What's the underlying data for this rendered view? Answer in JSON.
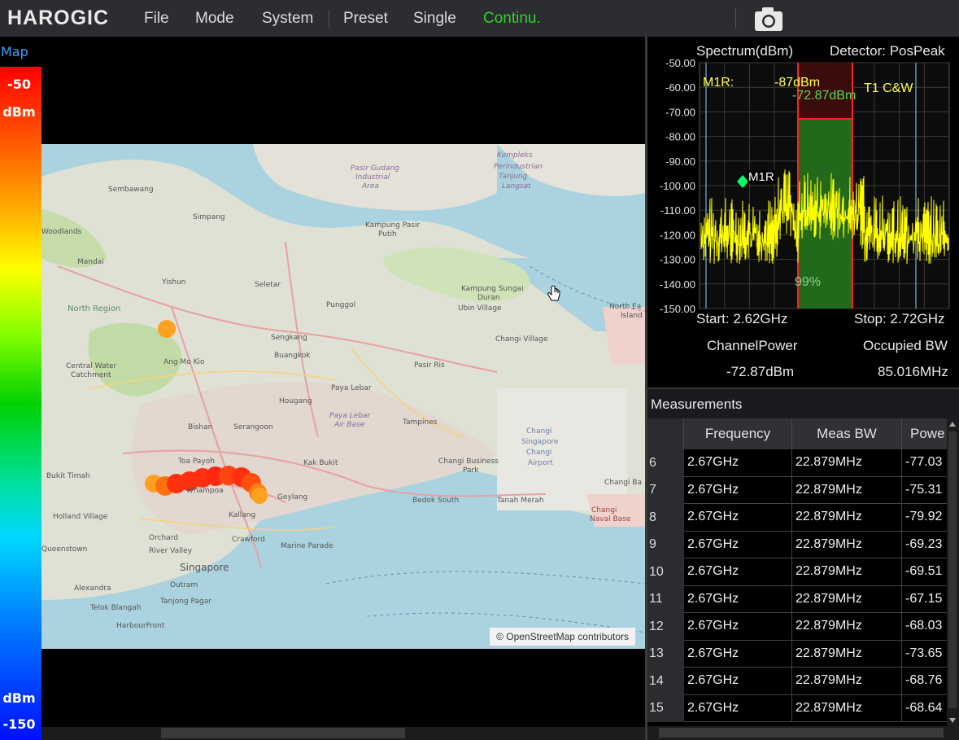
{
  "app": {
    "logo": "HAROGIC"
  },
  "menu": {
    "items": [
      "File",
      "Mode",
      "System",
      "Preset",
      "Single",
      "Continu."
    ],
    "active": "Continu."
  },
  "toolbar": {
    "camera_icon": "camera-icon"
  },
  "map": {
    "label": "Map",
    "colorbar": {
      "top_value": "-50",
      "top_unit": "dBm",
      "bottom_unit": "dBm",
      "bottom_value": "-150"
    },
    "attribution": "© OpenStreetMap contributors",
    "places": [
      "Sembawang",
      "Simpang",
      "Woodlands",
      "Mandai",
      "Yishun",
      "Seletar",
      "Punggol",
      "North Region",
      "Sengkang",
      "Buangkok",
      "Ang Mo Kio",
      "Central Water Catchment",
      "Hougang",
      "Paya Lebar",
      "Pasir Ris",
      "Tampines",
      "Bishan",
      "Serangoon",
      "Toa Payoh",
      "Kak Bukit",
      "Changi Village",
      "Changi Business Park",
      "Bukit Timah",
      "Whampoa",
      "Geylang",
      "Bedok South",
      "Tanah Merah",
      "Holland Village",
      "Kallang",
      "Marine Parade",
      "Orchard",
      "Crawford",
      "Queenstown",
      "River Valley",
      "Singapore",
      "Alexandra",
      "Outram",
      "Tanjong Pagar",
      "Telok Blangah",
      "HarbourFront",
      "Kampong Pasir Putih",
      "Pasir Gudang Industrial Area",
      "Kompleks Perindustrian Tanjung Langsat",
      "Kampung Sungai Duran",
      "Ubin Village",
      "North Eastern Islands",
      "Changi Singapore Changi Airport",
      "Changi Bay",
      "Changi Naval Base",
      "Paya Lebar Air Base"
    ]
  },
  "spectrum": {
    "title": "Spectrum(dBm)",
    "detector": "Detector: PosPeak",
    "yticks": [
      "-50.00",
      "-60.00",
      "-70.00",
      "-80.00",
      "-90.00",
      "-100.00",
      "-110.00",
      "-120.00",
      "-130.00",
      "-140.00",
      "-150.00"
    ],
    "ylim": [
      -150,
      -50
    ],
    "marker_readout_label": "M1R:",
    "marker_readout_value": "-87dBm",
    "channel_readout": "-72.87dBm",
    "trace_label": "T1 C&W",
    "marker_name": "M1R",
    "occupied_percent": "99%",
    "start": "Start: 2.62GHz",
    "stop": "Stop: 2.72GHz",
    "channel_power_label": "ChannelPower",
    "occupied_bw_label": "Occupied BW",
    "channel_power_value": "-72.87dBm",
    "occupied_bw_value": "85.016MHz"
  },
  "measurements": {
    "title": "Measurements",
    "columns": [
      "Frequency",
      "Meas BW",
      "Powe"
    ],
    "rows": [
      {
        "idx": "6",
        "freq": "2.67GHz",
        "bw": "22.879MHz",
        "power": "-77.03"
      },
      {
        "idx": "7",
        "freq": "2.67GHz",
        "bw": "22.879MHz",
        "power": "-75.31"
      },
      {
        "idx": "8",
        "freq": "2.67GHz",
        "bw": "22.879MHz",
        "power": "-79.92"
      },
      {
        "idx": "9",
        "freq": "2.67GHz",
        "bw": "22.879MHz",
        "power": "-69.23"
      },
      {
        "idx": "10",
        "freq": "2.67GHz",
        "bw": "22.879MHz",
        "power": "-69.51"
      },
      {
        "idx": "11",
        "freq": "2.67GHz",
        "bw": "22.879MHz",
        "power": "-67.15"
      },
      {
        "idx": "12",
        "freq": "2.67GHz",
        "bw": "22.879MHz",
        "power": "-68.03"
      },
      {
        "idx": "13",
        "freq": "2.67GHz",
        "bw": "22.879MHz",
        "power": "-73.65"
      },
      {
        "idx": "14",
        "freq": "2.67GHz",
        "bw": "22.879MHz",
        "power": "-68.76"
      },
      {
        "idx": "15",
        "freq": "2.67GHz",
        "bw": "22.879MHz",
        "power": "-68.64"
      }
    ]
  },
  "colors": {
    "accent_blue": "#3aa0ff",
    "active_menu": "#33d12a",
    "trace": "#ffff00",
    "marker": "#00ff66",
    "channel_fill": "#1f7a1f",
    "band_edge": "#ff2020"
  }
}
